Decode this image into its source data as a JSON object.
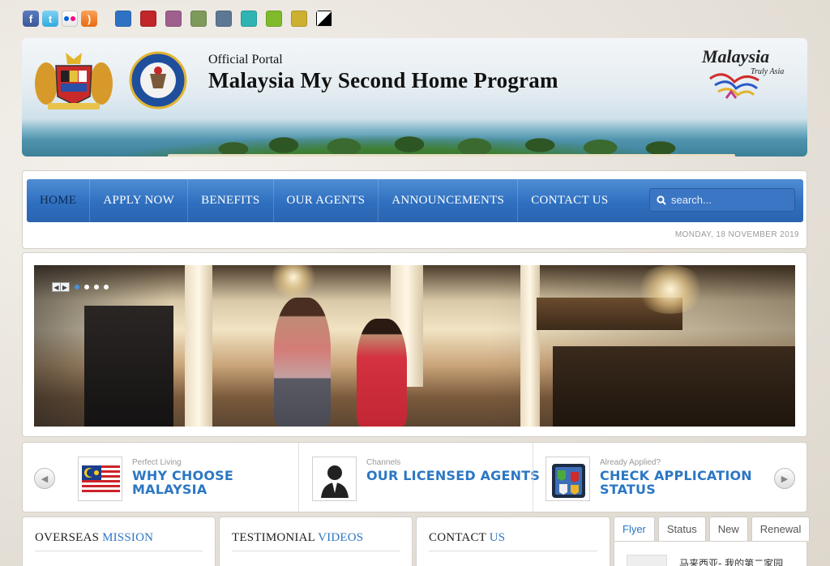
{
  "social": [
    {
      "name": "facebook",
      "glyph": "f"
    },
    {
      "name": "twitter",
      "glyph": "t"
    },
    {
      "name": "flickr",
      "glyph": ""
    },
    {
      "name": "rss",
      "glyph": ")"
    }
  ],
  "theme_colors": [
    "#2f72c4",
    "#c0262a",
    "#a0608e",
    "#7d9a5a",
    "#5d7895",
    "#2fb4b4",
    "#7fbb2a",
    "#ccb030",
    "split-black-white"
  ],
  "header": {
    "subtitle": "Official Portal",
    "title": "Malaysia My Second Home Program",
    "logo_word": "Malaysia",
    "logo_tagline": "Truly Asia"
  },
  "nav": {
    "items": [
      "HOME",
      "APPLY NOW",
      "BENEFITS",
      "OUR AGENTS",
      "ANNOUNCEMENTS",
      "CONTACT US"
    ],
    "active_index": 0,
    "search_placeholder": "search..."
  },
  "date": "MONDAY, 18 NOVEMBER 2019",
  "slider": {
    "dots": 4,
    "active_dot": 0
  },
  "features": [
    {
      "kicker": "Perfect Living",
      "line1": "WHY CHOOSE",
      "line2": "MALAYSIA",
      "icon": "malaysia-flag-icon"
    },
    {
      "kicker": "Channels",
      "line1": "OUR LICENSED AGENTS",
      "line2": "",
      "icon": "agent-icon"
    },
    {
      "kicker": "Already Applied?",
      "line1": "CHECK APPLICATION",
      "line2": "STATUS",
      "icon": "checklist-icon"
    }
  ],
  "boxes": [
    {
      "plain": "OVERSEAS ",
      "accent": "MISSION"
    },
    {
      "plain": "TESTIMONIAL ",
      "accent": "VIDEOS"
    },
    {
      "plain": "CONTACT ",
      "accent": "US"
    }
  ],
  "tabs": [
    "Flyer",
    "Status",
    "New",
    "Renewal"
  ],
  "tab_item": "马来西亚- 我的第二家园"
}
